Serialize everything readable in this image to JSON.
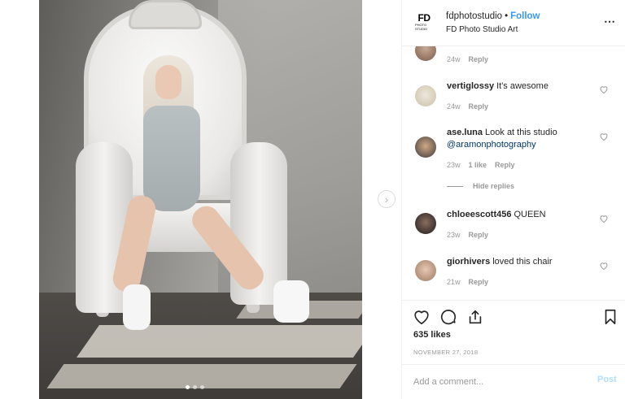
{
  "post": {
    "account": {
      "logo_text": "FD",
      "logo_subtext": "PHOTO STUDIO",
      "username": "fdphotostudio",
      "separator": "•",
      "follow_label": "Follow",
      "full_name": "FD Photo Studio Art"
    },
    "more_icon": "more-horizontal-icon",
    "carousel": {
      "slide_count": 3,
      "active_index": 0
    },
    "comments": [
      {
        "username": "",
        "text": "",
        "time": "24w",
        "reply_label": "Reply",
        "likes": ""
      },
      {
        "username": "vertiglossy",
        "text": "It's awesome⁣⁣",
        "time": "24w",
        "reply_label": "Reply",
        "likes": ""
      },
      {
        "username": "ase.luna",
        "text": "Look at this studio",
        "mention": "@aramonphotography",
        "time": "23w",
        "likes": "1 like",
        "reply_label": "Reply"
      },
      {
        "username": "chloeescott456",
        "text": "QUEEN ⁣⁣",
        "time": "23w",
        "reply_label": "Reply",
        "likes": ""
      },
      {
        "username": "giorhivers",
        "text": "loved this chair",
        "time": "21w",
        "reply_label": "Reply",
        "likes": ""
      }
    ],
    "hide_replies_label": "Hide replies",
    "likes_count": "635 likes",
    "date": "NOVEMBER 27, 2018",
    "comment_input": {
      "placeholder": "Add a comment...",
      "value": ""
    },
    "post_button_label": "Post",
    "colors": {
      "accent": "#3897f0",
      "muted": "#999999",
      "text": "#262626",
      "post_disabled": "#b2dffc"
    }
  }
}
